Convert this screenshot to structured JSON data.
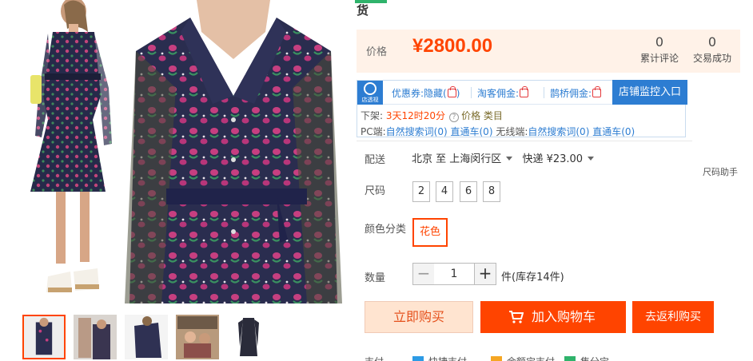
{
  "header": {
    "title_tail": "货"
  },
  "price": {
    "label": "价格",
    "value": "¥2800.00"
  },
  "stats": [
    {
      "num": "0",
      "label": "累计评论"
    },
    {
      "num": "0",
      "label": "交易成功"
    }
  ],
  "promo": {
    "logo_text": "店透视",
    "items": [
      "优惠券:隐藏(",
      "淘客佣金:",
      "鹊桥佣金:"
    ],
    "monitor_button": "店铺监控入口",
    "line1": {
      "prefix": "下架:",
      "time": "3天12时20分",
      "tags": "价格 类目"
    },
    "line2": {
      "pc_label": "PC端:",
      "pc_natural": "自然搜索词(0)",
      "pc_direct": "直通车(0)",
      "wireless_label": "无线端:",
      "wl_natural": "自然搜索词(0)",
      "wl_direct": "直通车(0)"
    }
  },
  "delivery": {
    "label": "配送",
    "from": "北京 至",
    "to": "上海闵行区",
    "shipping": "快递 ¥23.00"
  },
  "size": {
    "label": "尺码",
    "help": "尺码助手",
    "options": [
      "2",
      "4",
      "6",
      "8"
    ]
  },
  "color": {
    "label": "颜色分类",
    "selected": "花色"
  },
  "quantity": {
    "label": "数量",
    "minus": "−",
    "value": "1",
    "plus": "+",
    "stock": "件(库存14件)"
  },
  "buttons": {
    "buy_now": "立即购买",
    "add_cart": "加入购物车",
    "rebate": "去返利购买"
  },
  "bottom": {
    "label": "支付",
    "items": [
      "快捷支付",
      "余额宝支付",
      "集分宝"
    ]
  },
  "colors": {
    "accent": "#ff4400",
    "promo_blue": "#2d7dd2",
    "price_bg": "#fff2e8"
  }
}
